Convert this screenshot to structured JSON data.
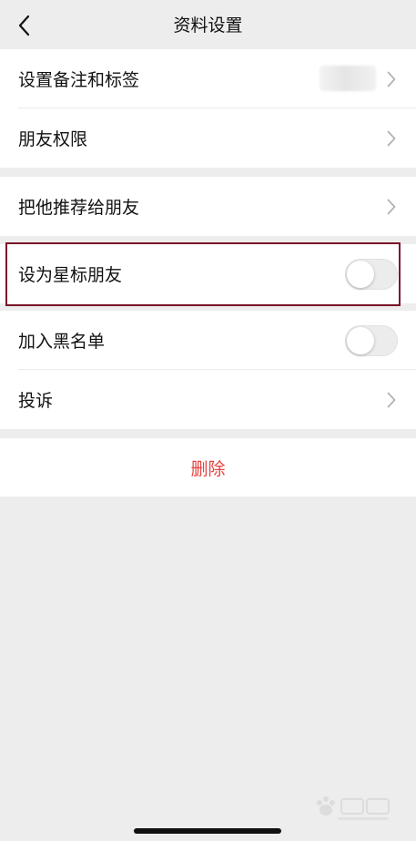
{
  "header": {
    "title": "资料设置"
  },
  "groups": [
    {
      "rows": [
        {
          "label": "设置备注和标签",
          "type": "chevron"
        },
        {
          "label": "朋友权限",
          "type": "chevron"
        }
      ]
    },
    {
      "rows": [
        {
          "label": "把他推荐给朋友",
          "type": "chevron"
        }
      ]
    },
    {
      "rows": [
        {
          "label": "设为星标朋友",
          "type": "toggle",
          "on": false
        }
      ]
    },
    {
      "rows": [
        {
          "label": "加入黑名单",
          "type": "toggle",
          "on": false
        },
        {
          "label": "投诉",
          "type": "chevron"
        }
      ]
    }
  ],
  "actions": {
    "delete_label": "删除"
  },
  "colors": {
    "background": "#ededed",
    "card": "#ffffff",
    "text": "#111111",
    "chevron": "#b3b3b3",
    "toggle_off": "#ececec",
    "delete": "#e64340",
    "highlight": "#7a1329"
  }
}
